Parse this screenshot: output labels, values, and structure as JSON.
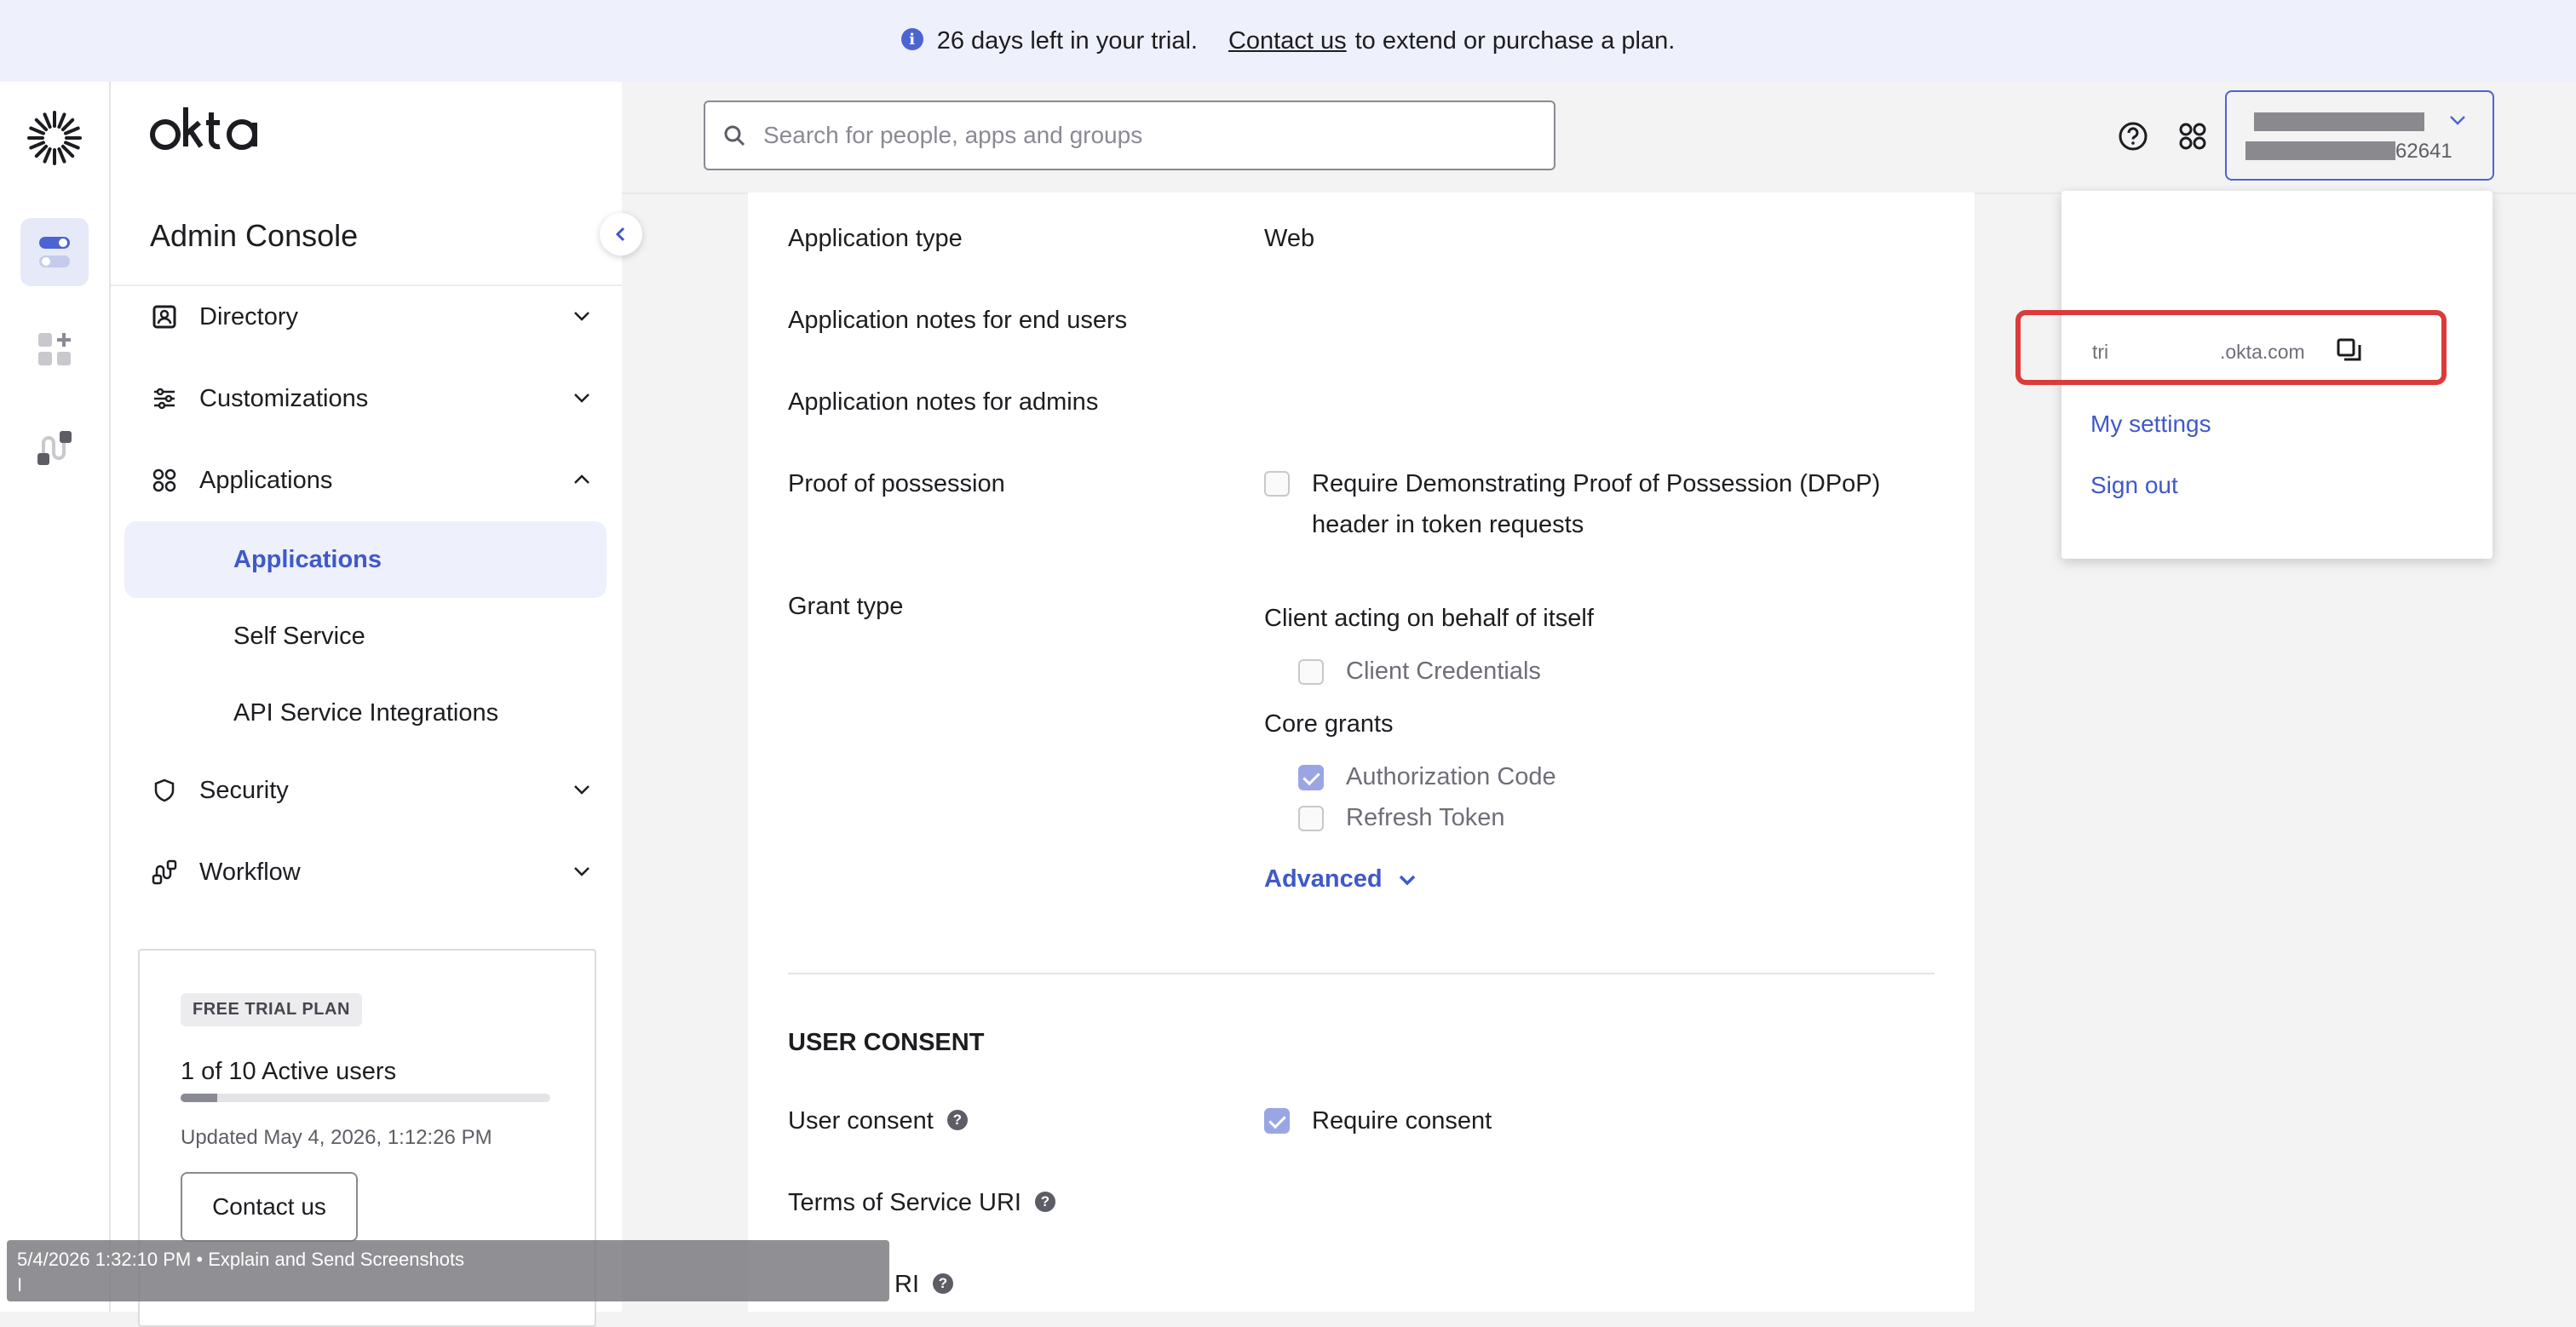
{
  "banner": {
    "message": "26 days left in your trial.",
    "link_text": "Contact us",
    "suffix": "to extend or purchase a plan.",
    "info_glyph": "i"
  },
  "rail": {
    "icons": [
      "okta-sunburst-logo-icon",
      "toggle-icon",
      "add-apps-icon",
      "workflow-icon"
    ]
  },
  "nav": {
    "console_title": "Admin Console",
    "items": [
      {
        "label": "Directory",
        "icon": "directory-icon",
        "expanded": false
      },
      {
        "label": "Customizations",
        "icon": "customizations-icon",
        "expanded": false
      },
      {
        "label": "Applications",
        "icon": "applications-icon",
        "expanded": true
      },
      {
        "label": "Security",
        "icon": "shield-icon",
        "expanded": false
      },
      {
        "label": "Workflow",
        "icon": "workflow-icon",
        "expanded": false
      }
    ],
    "sub_items": [
      {
        "label": "Applications",
        "active": true
      },
      {
        "label": "Self Service",
        "active": false
      },
      {
        "label": "API Service Integrations",
        "active": false
      }
    ]
  },
  "trial_card": {
    "badge": "FREE TRIAL PLAN",
    "users": "1 of 10 Active users",
    "users_fraction": 0.1,
    "updated": "Updated May 4, 2026, 1:12:26 PM",
    "contact_label": "Contact us"
  },
  "header": {
    "search_placeholder": "Search for people, apps and groups",
    "account_suffix": "62641"
  },
  "main": {
    "rows": {
      "app_type_label": "Application type",
      "app_type_value": "Web",
      "notes_end_users": "Application notes for end users",
      "notes_admins": "Application notes for admins",
      "pop_label": "Proof of possession",
      "pop_line1": "Require Demonstrating Proof of Possession (DPoP)",
      "pop_line2": "header in token requests",
      "grant_label": "Grant type",
      "client_behalf": "Client acting on behalf of itself",
      "client_credentials": "Client Credentials",
      "core_grants": "Core grants",
      "auth_code": "Authorization Code",
      "refresh_token": "Refresh Token",
      "advanced": "Advanced"
    },
    "consent": {
      "section_title": "USER CONSENT",
      "user_consent_label": "User consent",
      "require_consent": "Require consent",
      "tos_label": "Terms of Service URI",
      "policy_label_partial": "RI",
      "help_glyph": "?"
    }
  },
  "dropdown": {
    "org_prefix": "tri",
    "org_domain": ".okta.com",
    "my_settings": "My settings",
    "sign_out": "Sign out"
  },
  "toast": {
    "line1": "5/4/2026 1:32:10 PM • Explain and Send Screenshots",
    "line2": "I"
  },
  "colors": {
    "accent": "#3f59c8",
    "highlight": "#dc3b3b",
    "banner_bg": "#eef0fb"
  }
}
